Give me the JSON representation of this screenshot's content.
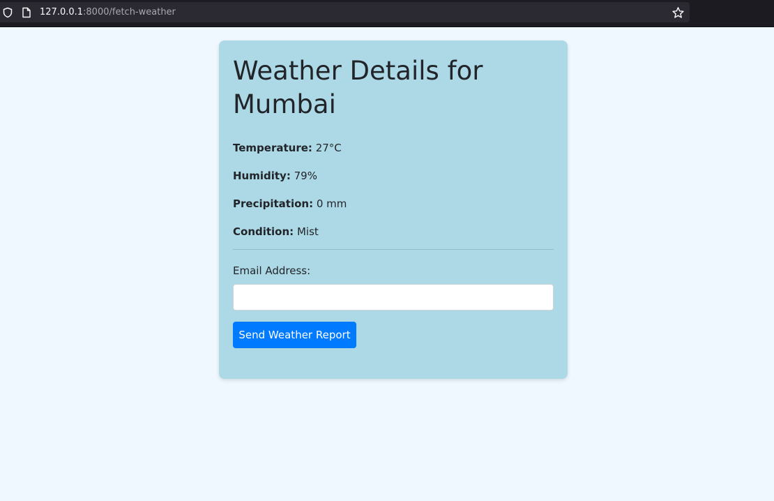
{
  "browser": {
    "url_host": "127.0.0.1",
    "url_rest": ":8000/fetch-weather"
  },
  "weather": {
    "title": "Weather Details for Mumbai",
    "temperature_label": "Temperature:",
    "temperature_value": "27°C",
    "humidity_label": "Humidity:",
    "humidity_value": "79%",
    "precipitation_label": "Precipitation:",
    "precipitation_value": "0 mm",
    "condition_label": "Condition:",
    "condition_value": "Mist"
  },
  "form": {
    "email_label": "Email Address:",
    "email_value": "",
    "send_label": "Send Weather Report"
  },
  "colors": {
    "page_background": "#eff7ff",
    "card_background": "#add8e6",
    "button_primary": "#007bff",
    "browser_chrome": "#1c1b22"
  },
  "icons": {
    "shield": "shield-icon",
    "page": "page-icon",
    "bookmark": "star-icon"
  }
}
